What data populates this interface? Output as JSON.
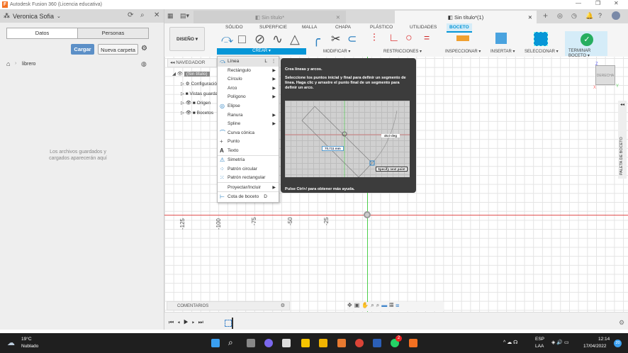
{
  "window": {
    "title": "Autodesk Fusion 360 (Licencia educativa)",
    "logo": "F"
  },
  "data_panel": {
    "user": "Veronica Sofia",
    "tabs": [
      "Datos",
      "Personas"
    ],
    "upload": "Cargar",
    "new_folder": "Nueva carpeta",
    "breadcrumb": "librero",
    "empty_message": "Los archivos guardados y cargados aparecerán aquí"
  },
  "doc_tabs": [
    {
      "label": "Sin título*",
      "active": false
    },
    {
      "label": "Sin título*(1)",
      "active": true
    }
  ],
  "ribbon": {
    "workspace": "DISEÑO ▾",
    "tabs": [
      "SÓLIDO",
      "SUPERFICIE",
      "MALLA",
      "CHAPA",
      "PLÁSTICO",
      "UTILIDADES",
      "BOCETO"
    ],
    "active_tab": "BOCETO",
    "groups": [
      "CREAR ▾",
      "MODIFICAR ▾",
      "RESTRICCIONES ▾",
      "INSPECCIONAR ▾",
      "INSERTAR ▾",
      "SELECCIONAR ▾",
      "TERMINAR BOCETO ▾"
    ]
  },
  "navigator": {
    "title": "NAVEGADOR",
    "root": "(Sin título)",
    "items": [
      "Configuración",
      "Vistas guardadas",
      "Origen",
      "Bocetos"
    ]
  },
  "create_menu": {
    "items": [
      {
        "label": "Línea",
        "shortcut": "L",
        "icon": "line-icon"
      },
      {
        "label": "Rectángulo",
        "submenu": true
      },
      {
        "label": "Círculo",
        "submenu": true
      },
      {
        "label": "Arco",
        "submenu": true
      },
      {
        "label": "Polígono",
        "submenu": true
      },
      {
        "label": "Elipse",
        "icon": "ellipse-icon"
      },
      {
        "label": "Ranura",
        "submenu": true
      },
      {
        "label": "Spline",
        "submenu": true
      },
      {
        "label": "Curva cónica",
        "icon": "conic-icon"
      },
      {
        "label": "Punto",
        "icon": "point-icon"
      },
      {
        "label": "Texto",
        "icon": "text-icon"
      },
      {
        "label": "Simetría",
        "icon": "mirror-icon"
      },
      {
        "label": "Patrón circular",
        "icon": "circular-pattern-icon"
      },
      {
        "label": "Patrón rectangular",
        "icon": "rect-pattern-icon"
      },
      {
        "label": "Proyectar/Incluir",
        "submenu": true
      },
      {
        "label": "Cota de boceto",
        "shortcut": "D",
        "icon": "dimension-icon"
      }
    ]
  },
  "tooltip": {
    "title": "Crea líneas y arcos.",
    "body": "Seleccione los puntos inicial y final para definir un segmento de línea. Haga clic y arrastre el punto final de un segmento para definir un arco.",
    "dim_length": "70.711 mm",
    "dim_angle": "45.0 deg",
    "prompt": "Specify next point",
    "footer": "Pulse Ctrl+/ para obtener más ayuda."
  },
  "viewcube": {
    "face": "DERECHA",
    "z": "Z",
    "x": "X",
    "y": "Y"
  },
  "sketch_palette": "PALETA DE BOCETO",
  "rulers": [
    "-125",
    "-100",
    "-75",
    "-50",
    "-25"
  ],
  "comments": "COMENTARIOS",
  "taskbar": {
    "weather_temp": "19°C",
    "weather_desc": "Nublado",
    "lang": "ESP",
    "lang2": "LAA",
    "time": "12:14",
    "date": "17/04/2022",
    "whatsapp_badge": "2",
    "notif": "20"
  },
  "colors": {
    "accent": "#0696d7",
    "axis_x": "#e05050",
    "axis_y": "#4ccf4c",
    "finish": "#27ae60"
  }
}
